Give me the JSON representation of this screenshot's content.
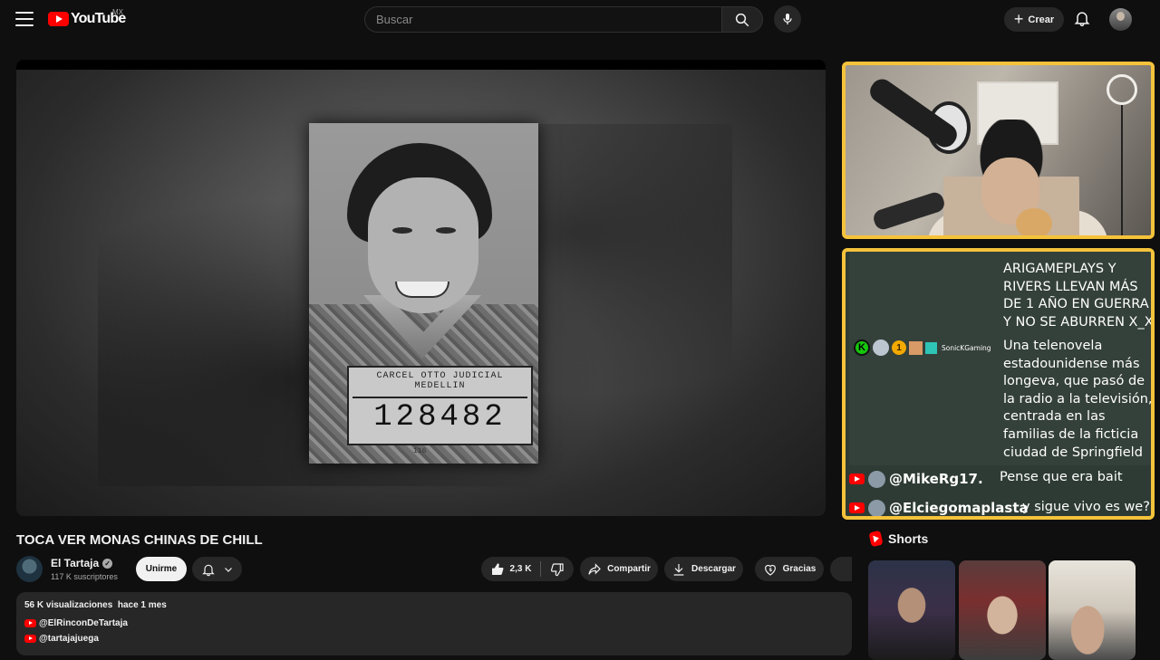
{
  "header": {
    "logo_text": "YouTube",
    "logo_country": "MX",
    "search_placeholder": "Buscar",
    "create_label": "Crear"
  },
  "player": {
    "mugshot_board_top": "CARCEL OTTO JUDICIAL\nMEDELLIN",
    "mugshot_number": "128482",
    "mugshot_small": "116"
  },
  "chat": {
    "message1_text": "ARIGAMEPLAYS Y RIVERS LLEVAN MÁS DE 1 AÑO EN GUERRA Y NO SE ABURREN X_X",
    "message2_user": "SonicKGaming",
    "message2_text": "Una telenovela estadounidense más longeva, que pasó de la radio a la televisión, centrada en las familias de la ficticia ciudad de Springfield",
    "message3_user": "@MikeRg17.",
    "message3_text": "Pense que era bait",
    "message4_user": "@Elciegomaplasta",
    "message4_text": "y sigue vivo es we?"
  },
  "video": {
    "title": "TOCA VER MONAS CHINAS DE CHILL",
    "channel_name": "El Tartaja",
    "subscribers": "117 K suscriptores",
    "join_label": "Unirme",
    "likes": "2,3 K",
    "share_label": "Compartir",
    "download_label": "Descargar",
    "thanks_label": "Gracias"
  },
  "description": {
    "views": "56 K visualizaciones",
    "date": "hace 1 mes",
    "links": [
      "@ElRinconDeTartaja",
      "@tartajajuega"
    ]
  },
  "shorts": {
    "heading": "Shorts"
  },
  "colors": {
    "accent_red": "#ff0000",
    "overlay_border": "#f5c33b",
    "background": "#0f0f0f"
  }
}
